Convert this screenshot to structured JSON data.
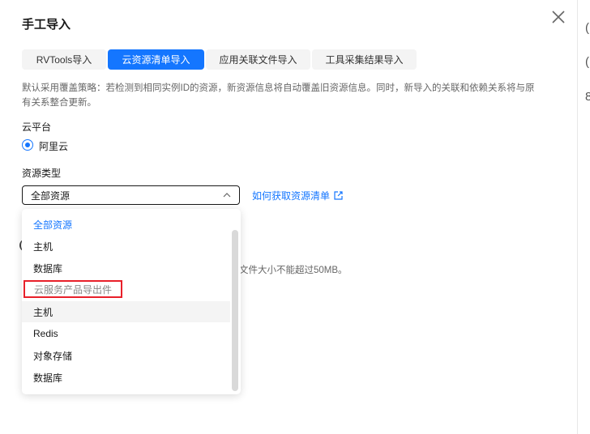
{
  "dialog": {
    "title": "手工导入",
    "close_icon": "close-icon"
  },
  "tabs": [
    {
      "label": "RVTools导入"
    },
    {
      "label": "云资源清单导入",
      "active": true
    },
    {
      "label": "应用关联文件导入"
    },
    {
      "label": "工具采集结果导入"
    }
  ],
  "description": "默认采用覆盖策略：若检测到相同实例ID的资源，新资源信息将自动覆盖旧资源信息。同时，新导入的关联和依赖关系将与原有关系整合更新。",
  "platform": {
    "label": "云平台",
    "option": "阿里云"
  },
  "resource_type": {
    "label": "资源类型",
    "value": "全部资源",
    "link": "如何获取资源清单"
  },
  "background_hint": "文件大小不能超过50MB。",
  "dropdown": {
    "items": [
      "全部资源",
      "主机",
      "数据库"
    ],
    "group_label": "云服务产品导出件",
    "group_items": [
      "主机",
      "Redis",
      "对象存储",
      "数据库"
    ]
  },
  "colors": {
    "accent": "#1476ff",
    "highlight": "#e8202a"
  }
}
